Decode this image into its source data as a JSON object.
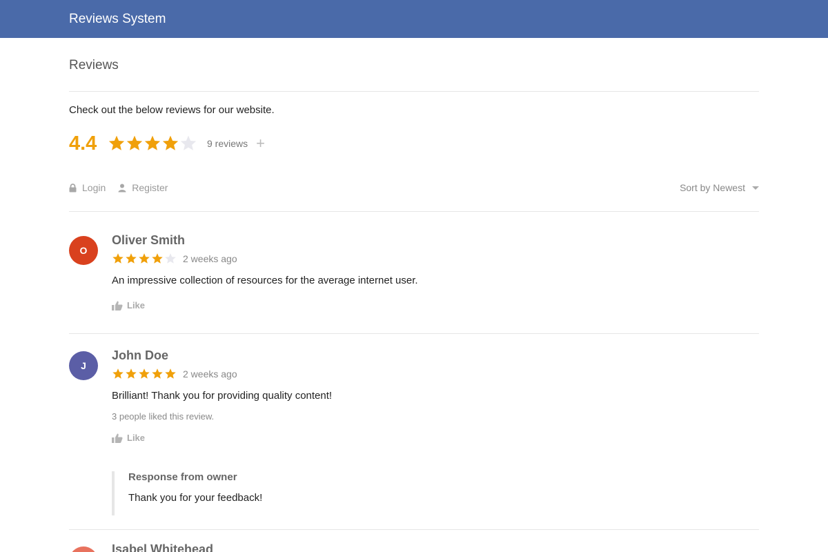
{
  "app": {
    "title": "Reviews System"
  },
  "page": {
    "title": "Reviews",
    "intro": "Check out the below reviews for our website.",
    "overall_score": "4.4",
    "overall_rating": 4.4,
    "review_count": "9 reviews",
    "add_icon": "plus-icon"
  },
  "auth": {
    "login_label": "Login",
    "login_icon": "lock-icon",
    "register_label": "Register",
    "register_icon": "user-icon"
  },
  "sort": {
    "label": "Sort by Newest"
  },
  "colors": {
    "header": "#4a6aa9",
    "star_filled": "#f0a00a",
    "star_empty": "#e8e8ee"
  },
  "reviews": [
    {
      "initial": "O",
      "avatar_color": "#d9411e",
      "name": "Oliver Smith",
      "rating": 4,
      "date": "2 weeks ago",
      "text": "An impressive collection of resources for the average internet user.",
      "likes_text": "",
      "like_label": "Like"
    },
    {
      "initial": "J",
      "avatar_color": "#5b5ea6",
      "name": "John Doe",
      "rating": 5,
      "date": "2 weeks ago",
      "text": "Brilliant! Thank you for providing quality content!",
      "likes_text": "3 people liked this review.",
      "like_label": "Like",
      "response": {
        "title": "Response from owner",
        "text": "Thank you for your feedback!"
      }
    },
    {
      "initial": "",
      "avatar_color": "#e8725e",
      "name": "Isabel Whitehead"
    }
  ]
}
